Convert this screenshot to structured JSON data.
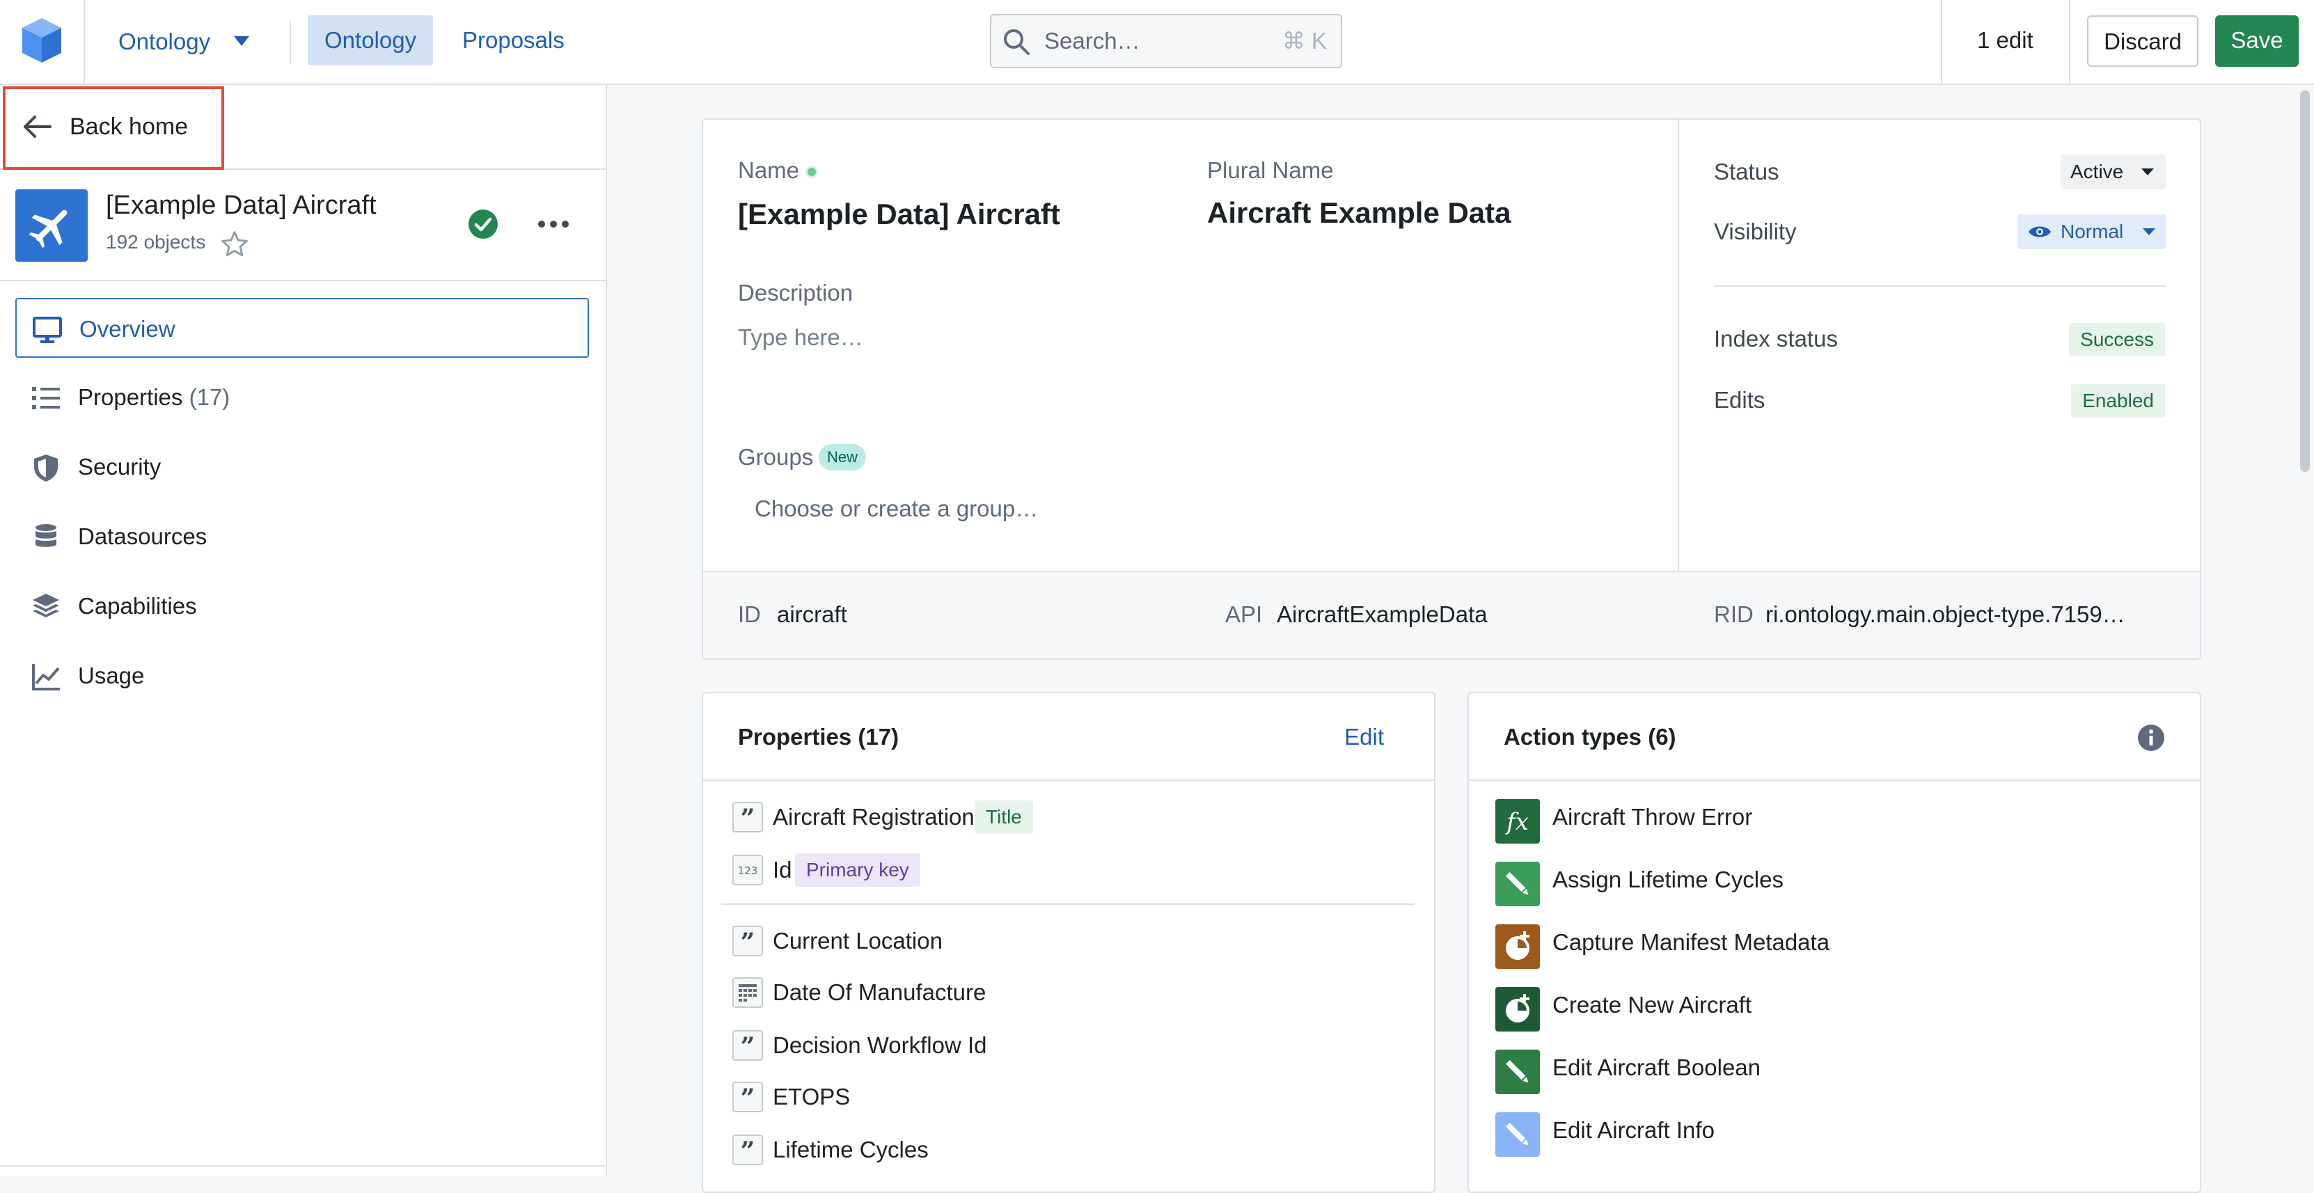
{
  "colors": {
    "accent": "#2d72d2",
    "save_green": "#238551",
    "success_bg": "#e6f4ea",
    "success_text": "#1c6e42",
    "new_tag_bg": "#b8ece4",
    "highlight_red": "#e34b3c"
  },
  "topbar": {
    "app_menu_label": "Ontology",
    "tabs": [
      {
        "label": "Ontology",
        "active": true
      },
      {
        "label": "Proposals",
        "active": false
      }
    ],
    "search_placeholder": "Search…",
    "search_shortcut": "⌘ K",
    "edits_count": "1 edit",
    "discard_label": "Discard",
    "save_label": "Save"
  },
  "sidebar": {
    "back_label": "Back home",
    "object": {
      "title": "[Example Data] Aircraft",
      "count": "192 objects"
    },
    "items": [
      {
        "label": "Overview",
        "icon": "desktop-icon",
        "selected": true
      },
      {
        "label": "Properties",
        "count": "(17)",
        "icon": "properties-list-icon"
      },
      {
        "label": "Security",
        "icon": "shield-icon"
      },
      {
        "label": "Datasources",
        "icon": "database-icon"
      },
      {
        "label": "Capabilities",
        "icon": "layers-icon"
      },
      {
        "label": "Usage",
        "icon": "timeline-chart-icon"
      }
    ]
  },
  "overview": {
    "name_label": "Name",
    "name_value": "[Example Data] Aircraft",
    "plural_label": "Plural Name",
    "plural_value": "Aircraft Example Data",
    "description_label": "Description",
    "description_placeholder": "Type here…",
    "groups_label": "Groups",
    "groups_tag": "New",
    "groups_placeholder": "Choose or create a group…",
    "status_label": "Status",
    "status_value": "Active",
    "visibility_label": "Visibility",
    "visibility_value": "Normal",
    "index_status_label": "Index status",
    "index_status_value": "Success",
    "edits_label": "Edits",
    "edits_value": "Enabled",
    "id_label": "ID",
    "id_value": "aircraft",
    "api_label": "API",
    "api_value": "AircraftExampleData",
    "rid_label": "RID",
    "rid_value": "ri.ontology.main.object-type.7159…"
  },
  "properties_card": {
    "title": "Properties (17)",
    "edit_label": "Edit",
    "key_rows": [
      {
        "name": "Aircraft Registration",
        "type_icon": "quote-icon",
        "tag": "Title"
      },
      {
        "name": "Id",
        "type_icon": "numeric-icon",
        "tag": "Primary key"
      }
    ],
    "rows": [
      {
        "name": "Current Location",
        "type_icon": "quote-icon"
      },
      {
        "name": "Date Of Manufacture",
        "type_icon": "calendar-icon"
      },
      {
        "name": "Decision Workflow Id",
        "type_icon": "quote-icon"
      },
      {
        "name": "ETOPS",
        "type_icon": "quote-icon"
      },
      {
        "name": "Lifetime Cycles",
        "type_icon": "quote-icon"
      }
    ]
  },
  "actions_card": {
    "title": "Action types (6)",
    "items": [
      {
        "name": "Aircraft Throw Error",
        "icon": "function-icon",
        "color": "#1f6b3d"
      },
      {
        "name": "Assign Lifetime Cycles",
        "icon": "edit-icon",
        "color": "#3a9e5a"
      },
      {
        "name": "Capture Manifest Metadata",
        "icon": "add-clock-icon",
        "color": "#9c5a1c"
      },
      {
        "name": "Create New Aircraft",
        "icon": "add-clock-icon",
        "color": "#1f5a36"
      },
      {
        "name": "Edit Aircraft Boolean",
        "icon": "edit-icon",
        "color": "#2e7d44"
      },
      {
        "name": "Edit Aircraft Info",
        "icon": "edit-icon",
        "color": "#8ab4f8"
      }
    ]
  }
}
